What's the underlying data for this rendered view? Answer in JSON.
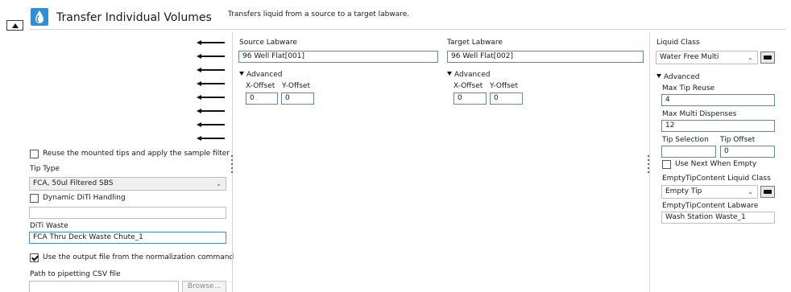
{
  "header": {
    "title": "Transfer Individual Volumes",
    "description": "Transfers liquid from a source to a target labware."
  },
  "left": {
    "reuse_tips_label": "Reuse the mounted tips and apply the sample filter",
    "reuse_tips_checked": false,
    "tip_type_label": "Tip Type",
    "tip_type_value": "FCA, 50ul Filtered SBS",
    "dynamic_diti_label": "Dynamic DiTi Handling",
    "dynamic_diti_checked": false,
    "dynamic_diti_value": "",
    "diti_waste_label": "DiTi Waste",
    "diti_waste_value": "FCA Thru Deck Waste Chute_1",
    "use_output_label": "Use the output file from the normalization command",
    "use_output_checked": true,
    "csv_path_label": "Path to pipetting CSV file",
    "csv_path_value": "",
    "browse_label": "Browse..."
  },
  "source": {
    "label": "Source Labware",
    "value": "96 Well Flat[001]",
    "advanced_label": "Advanced",
    "x_offset_label": "X-Offset",
    "y_offset_label": "Y-Offset",
    "x_offset": "0",
    "y_offset": "0"
  },
  "target": {
    "label": "Target Labware",
    "value": "96 Well Flat[002]",
    "advanced_label": "Advanced",
    "x_offset_label": "X-Offset",
    "y_offset_label": "Y-Offset",
    "x_offset": "0",
    "y_offset": "0"
  },
  "liquid": {
    "class_label": "Liquid Class",
    "class_value": "Water Free Multi",
    "advanced_label": "Advanced",
    "max_tip_reuse_label": "Max Tip Reuse",
    "max_tip_reuse": "4",
    "max_multi_label": "Max Multi Dispenses",
    "max_multi": "12",
    "tip_selection_label": "Tip Selection",
    "tip_selection": "",
    "tip_offset_label": "Tip Offset",
    "tip_offset": "0",
    "use_next_label": "Use Next When Empty",
    "use_next_checked": false,
    "empty_class_label": "EmptyTipContent Liquid Class",
    "empty_class_value": "Empty Tip",
    "empty_labware_label": "EmptyTipContent Labware",
    "empty_labware_value": "Wash Station Waste_1"
  },
  "icons": {
    "command": "water-drop-icon",
    "collapse": "collapse-triangle-icon",
    "liquid_class_button": "liquid-class-editor-icon",
    "marker": "black-arrow-marker-icon"
  },
  "colors": {
    "accent": "#4a8ccb",
    "icon_bg": "#2f8ed6"
  }
}
